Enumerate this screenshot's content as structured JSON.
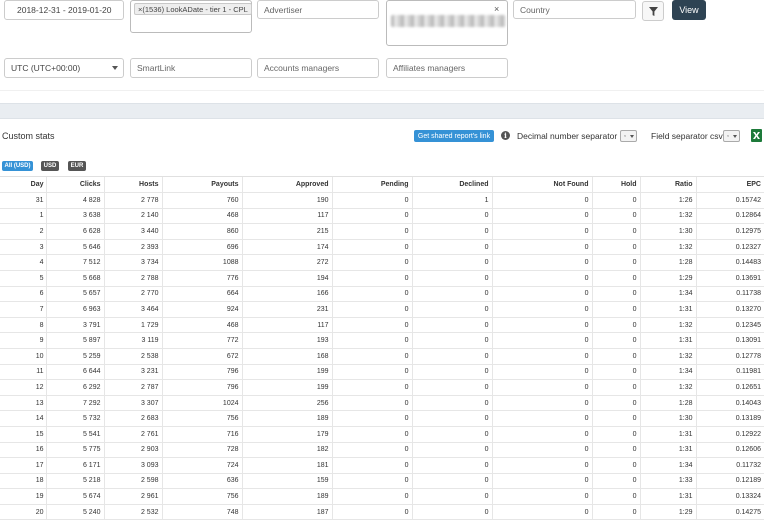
{
  "filters": {
    "date_range": "2018-12-31 - 2019-01-20",
    "offer_tag": "(1536) LookADate - tier 1 - CPL",
    "offer_tag_remove": "×",
    "advertiser_placeholder": "Advertiser",
    "country_placeholder": "Country",
    "clear_symbol": "×",
    "view_label": "View",
    "timezone": "UTC (UTC+00:00)",
    "smartlink_placeholder": "SmartLink",
    "accounts_managers_placeholder": "Accounts managers",
    "affiliates_managers_placeholder": "Affiliates managers"
  },
  "stats": {
    "title": "Custom stats",
    "shared_report_label": "Get shared report's link",
    "info_glyph": "i",
    "decimal_separator_label": "Decimal number separator",
    "decimal_separator_value": ",",
    "field_separator_label": "Field separator csv",
    "field_separator_value": ",",
    "currency_buttons": [
      "All (USD)",
      "USD",
      "EUR"
    ],
    "colors": {
      "primary": "#3592d6",
      "dark": "#2e4353",
      "currency_dark": "#444444",
      "excel": "#1d7a3a"
    }
  },
  "table": {
    "columns": [
      "Day",
      "Clicks",
      "Hosts",
      "Payouts",
      "Approved",
      "Pending",
      "Declined",
      "Not Found",
      "Hold",
      "Ratio",
      "EPC"
    ],
    "rows": [
      [
        "31",
        "4 828",
        "2 778",
        "760",
        "190",
        "0",
        "1",
        "0",
        "0",
        "1:26",
        "0.15742"
      ],
      [
        "1",
        "3 638",
        "2 140",
        "468",
        "117",
        "0",
        "0",
        "0",
        "0",
        "1:32",
        "0.12864"
      ],
      [
        "2",
        "6 628",
        "3 440",
        "860",
        "215",
        "0",
        "0",
        "0",
        "0",
        "1:30",
        "0.12975"
      ],
      [
        "3",
        "5 646",
        "2 393",
        "696",
        "174",
        "0",
        "0",
        "0",
        "0",
        "1:32",
        "0.12327"
      ],
      [
        "4",
        "7 512",
        "3 734",
        "1088",
        "272",
        "0",
        "0",
        "0",
        "0",
        "1:28",
        "0.14483"
      ],
      [
        "5",
        "5 668",
        "2 788",
        "776",
        "194",
        "0",
        "0",
        "0",
        "0",
        "1:29",
        "0.13691"
      ],
      [
        "6",
        "5 657",
        "2 770",
        "664",
        "166",
        "0",
        "0",
        "0",
        "0",
        "1:34",
        "0.11738"
      ],
      [
        "7",
        "6 963",
        "3 464",
        "924",
        "231",
        "0",
        "0",
        "0",
        "0",
        "1:31",
        "0.13270"
      ],
      [
        "8",
        "3 791",
        "1 729",
        "468",
        "117",
        "0",
        "0",
        "0",
        "0",
        "1:32",
        "0.12345"
      ],
      [
        "9",
        "5 897",
        "3 119",
        "772",
        "193",
        "0",
        "0",
        "0",
        "0",
        "1:31",
        "0.13091"
      ],
      [
        "10",
        "5 259",
        "2 538",
        "672",
        "168",
        "0",
        "0",
        "0",
        "0",
        "1:32",
        "0.12778"
      ],
      [
        "11",
        "6 644",
        "3 231",
        "796",
        "199",
        "0",
        "0",
        "0",
        "0",
        "1:34",
        "0.11981"
      ],
      [
        "12",
        "6 292",
        "2 787",
        "796",
        "199",
        "0",
        "0",
        "0",
        "0",
        "1:32",
        "0.12651"
      ],
      [
        "13",
        "7 292",
        "3 307",
        "1024",
        "256",
        "0",
        "0",
        "0",
        "0",
        "1:28",
        "0.14043"
      ],
      [
        "14",
        "5 732",
        "2 683",
        "756",
        "189",
        "0",
        "0",
        "0",
        "0",
        "1:30",
        "0.13189"
      ],
      [
        "15",
        "5 541",
        "2 761",
        "716",
        "179",
        "0",
        "0",
        "0",
        "0",
        "1:31",
        "0.12922"
      ],
      [
        "16",
        "5 775",
        "2 903",
        "728",
        "182",
        "0",
        "0",
        "0",
        "0",
        "1:31",
        "0.12606"
      ],
      [
        "17",
        "6 171",
        "3 093",
        "724",
        "181",
        "0",
        "0",
        "0",
        "0",
        "1:34",
        "0.11732"
      ],
      [
        "18",
        "5 218",
        "2 598",
        "636",
        "159",
        "0",
        "0",
        "0",
        "0",
        "1:33",
        "0.12189"
      ],
      [
        "19",
        "5 674",
        "2 961",
        "756",
        "189",
        "0",
        "0",
        "0",
        "0",
        "1:31",
        "0.13324"
      ],
      [
        "20",
        "5 240",
        "2 532",
        "748",
        "187",
        "0",
        "0",
        "0",
        "0",
        "1:29",
        "0.14275"
      ]
    ]
  }
}
